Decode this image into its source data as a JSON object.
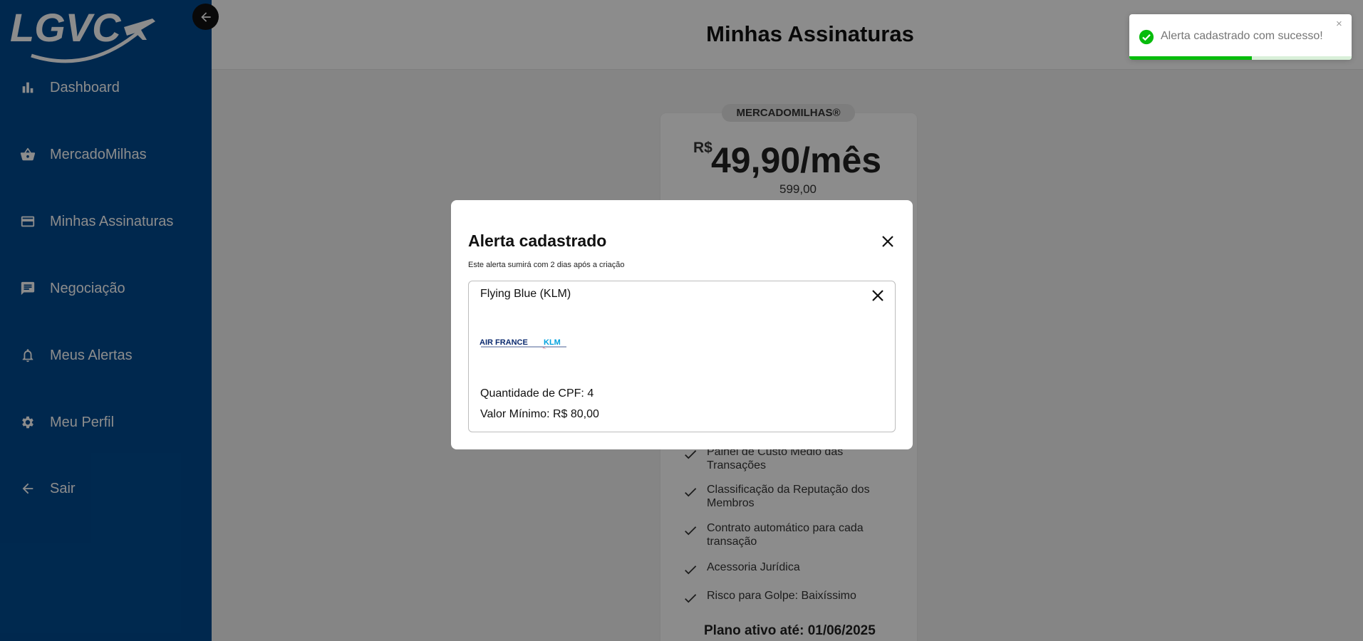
{
  "sidebar": {
    "logo_text": "LGVC",
    "items": [
      {
        "label": "Dashboard",
        "icon": "bar-chart-icon"
      },
      {
        "label": "MercadoMilhas",
        "icon": "basket-icon"
      },
      {
        "label": "Minhas Assinaturas",
        "icon": "credit-card-icon"
      },
      {
        "label": "Negociação",
        "icon": "chat-icon"
      },
      {
        "label": "Meus Alertas",
        "icon": "bell-icon"
      },
      {
        "label": "Meu Perfil",
        "icon": "gear-icon"
      },
      {
        "label": "Sair",
        "icon": "arrow-left-icon"
      }
    ]
  },
  "header": {
    "title": "Minhas Assinaturas"
  },
  "plan": {
    "badge": "MERCADOMILHAS®",
    "currency": "R$",
    "price": "49,90/mês",
    "annual": "599,00",
    "features": [
      "Painel de Custo Médio das Transações",
      "Classificação da Reputação dos Membros",
      "Contrato automático para cada transação",
      "Acessoria Jurídica",
      "Risco para Golpe: Baixíssimo"
    ],
    "active_until": "Plano ativo até: 01/06/2025"
  },
  "modal": {
    "title": "Alerta cadastrado",
    "subtitle": "Este alerta sumirá com 2 dias após a criação",
    "alert": {
      "program": "Flying Blue (KLM)",
      "logo_text_1": "AIR FRANCE",
      "logo_text_2": "KLM",
      "cpf": "Quantidade de CPF: 4",
      "min_value": "Valor Mínimo: R$ 80,00"
    }
  },
  "toast": {
    "message": "Alerta cadastrado com sucesso!",
    "close": "×",
    "progress": 0.55,
    "color": "#07bc0c"
  }
}
